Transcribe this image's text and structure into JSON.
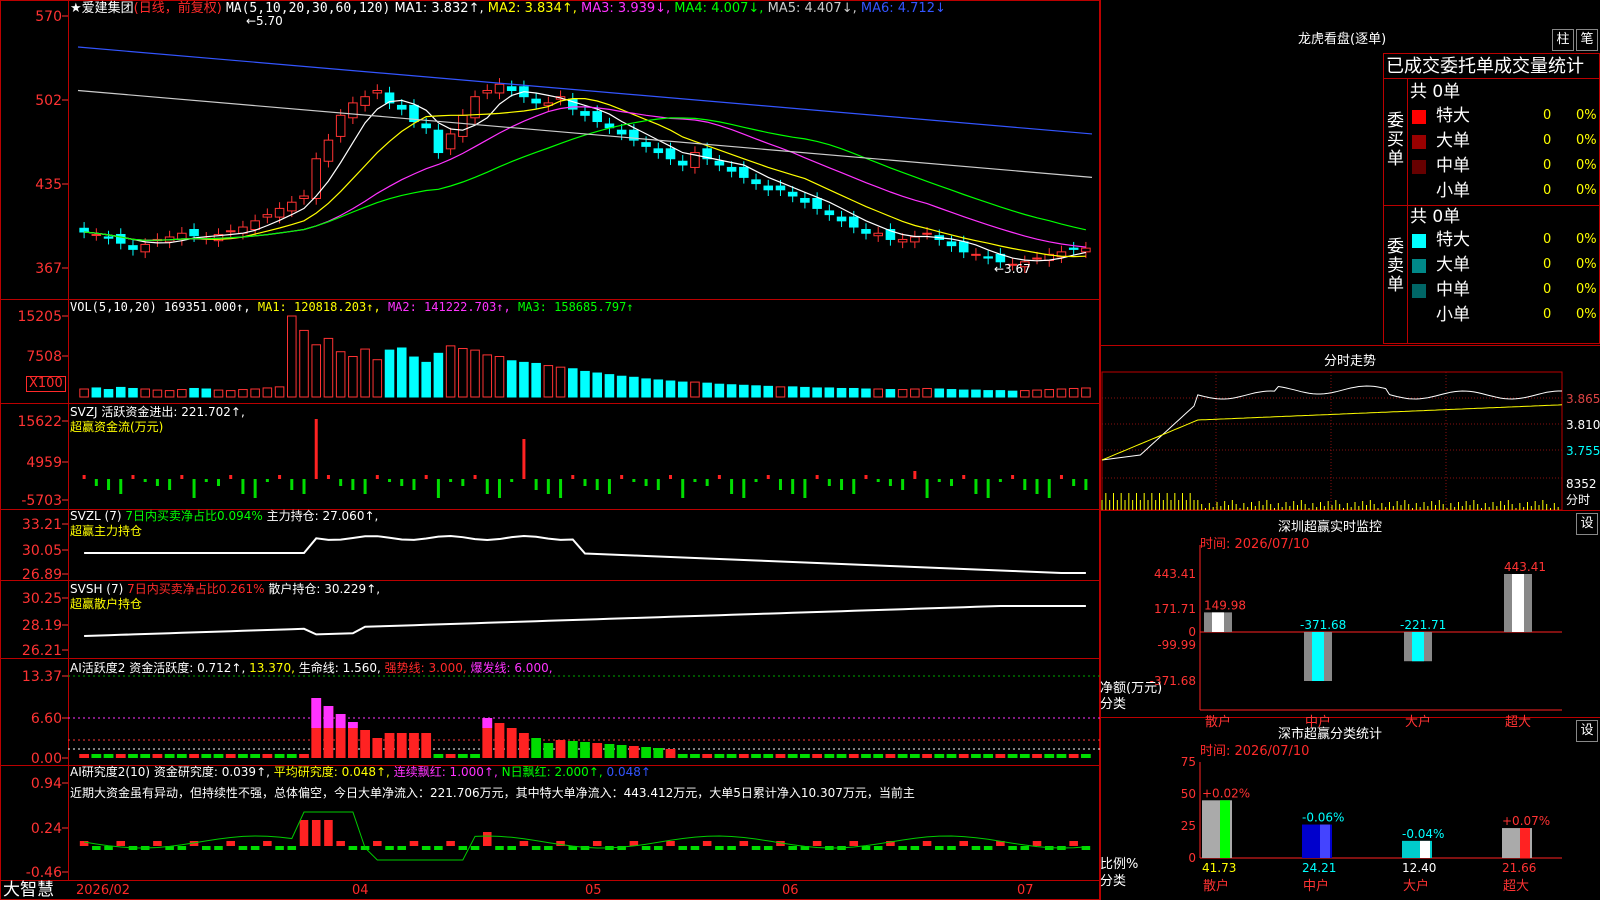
{
  "main": {
    "stock_name": "★爱建集团",
    "period": "(日线，前复权)",
    "ma_params": "MA(5,10,20,30,60,120)",
    "ma_values": [
      {
        "label": "MA1: 3.832↑,",
        "color": "#ffffff"
      },
      {
        "label": "MA2: 3.834↑,",
        "color": "#ffff00"
      },
      {
        "label": "MA3: 3.939↓,",
        "color": "#ff33ff"
      },
      {
        "label": "MA4: 4.007↓,",
        "color": "#00ff00"
      },
      {
        "label": "MA5: 4.407↓,",
        "color": "#cccccc"
      },
      {
        "label": "MA6: 4.712↓",
        "color": "#3355ff"
      }
    ],
    "axis": [
      "570",
      "502",
      "435",
      "367"
    ],
    "high_marker": "←5.70",
    "low_marker": "←3.67"
  },
  "volume": {
    "header": "VOL(5,10,20)",
    "value": "169351.000↑,",
    "ma1": "MA1: 120818.203↑,",
    "ma2": "MA2: 141222.703↑,",
    "ma3": "MA3: 158685.797↑",
    "axis": [
      "15205",
      "7508"
    ],
    "unit": "X100"
  },
  "svzj": {
    "header": "SVZJ",
    "line1": "活跃资金进出: 221.702↑,",
    "line2": "超赢资金流(万元)",
    "axis": [
      "15622",
      "4959",
      "-5703"
    ]
  },
  "svzl": {
    "header": "SVZL (7)",
    "ratio": "7日内买卖净占比0.094%",
    "hold": "主力持仓: 27.060↑,",
    "line2": "超赢主力持仓",
    "axis": [
      "33.21",
      "30.05",
      "26.89"
    ]
  },
  "svsh": {
    "header": "SVSH (7)",
    "ratio": "7日内买卖净占比0.261%",
    "hold": "散户持仓: 30.229↑,",
    "line2": "超赢散户持仓",
    "axis": [
      "30.25",
      "28.19",
      "26.21"
    ]
  },
  "ai_active": {
    "header": "AI活跃度2",
    "v1": "资金活跃度: 0.712↑,",
    "v2": "13.370,",
    "v3": "生命线: 1.560,",
    "v4": "强势线: 3.000,",
    "v5": "爆发线: 6.000,",
    "axis": [
      "13.37",
      "6.60",
      "0.00"
    ]
  },
  "ai_research": {
    "header": "AI研究度2(10)",
    "v1": "资金研究度: 0.039↑,",
    "v2": "平均研究度: 0.048↑,",
    "v3": "连续飘红: 1.000↑,",
    "v4": "N日飘红: 2.000↑,",
    "v5": "0.048↑",
    "note": "近期大资金虽有异动，但持续性不强，总体偏空，今日大单净流入：221.706万元，其中特大单净流入：443.412万元，大单5日累计净入10.307万元，当前主",
    "axis": [
      "0.94",
      "0.24",
      "-0.46"
    ]
  },
  "x_axis": {
    "brand": "大智慧",
    "labels": [
      "2026/02",
      "04",
      "05",
      "06",
      "07"
    ]
  },
  "right": {
    "lhb_title": "龙虎看盘(逐单)",
    "btn_zhu": "柱",
    "btn_bi": "笔",
    "tabs": "已成交委托单成交量统计",
    "buy_label": "委买单",
    "sell_label": "委卖单",
    "buy_total": "共 0单",
    "sell_total": "共 0单",
    "buy_rows": [
      {
        "name": "特大",
        "count": "0",
        "pct": "0%",
        "color": "#ff0000"
      },
      {
        "name": "大单",
        "count": "0",
        "pct": "0%",
        "color": "#990000"
      },
      {
        "name": "中单",
        "count": "0",
        "pct": "0%",
        "color": "#660000"
      },
      {
        "name": "小单",
        "count": "0",
        "pct": "0%",
        "color": ""
      }
    ],
    "sell_rows": [
      {
        "name": "特大",
        "count": "0",
        "pct": "0%",
        "color": "#00ffff"
      },
      {
        "name": "大单",
        "count": "0",
        "pct": "0%",
        "color": "#008888"
      },
      {
        "name": "中单",
        "count": "0",
        "pct": "0%",
        "color": "#006666"
      },
      {
        "name": "小单",
        "count": "0",
        "pct": "0%",
        "color": ""
      }
    ],
    "fs_title": "分时走势",
    "fs_axis": [
      "3.865",
      "3.810",
      "3.755"
    ],
    "fs_vol": "8352",
    "fs_unit": "分时",
    "sz_title": "深圳超赢实时监控",
    "sz_btn": "设",
    "sz_time": "时间: 2026/07/10",
    "sz_axis": [
      "443.41",
      "171.71",
      "0",
      "-99.99",
      "-371.68"
    ],
    "sz_axis_label1": "净额(万元)",
    "sz_axis_label2": "分类",
    "sz_bars": [
      {
        "cat": "散户",
        "value": "149.98"
      },
      {
        "cat": "中户",
        "value": "-371.68"
      },
      {
        "cat": "大户",
        "value": "-221.71"
      },
      {
        "cat": "超大",
        "value": "443.41"
      }
    ],
    "sm_title": "深市超赢分类统计",
    "sm_btn": "设",
    "sm_time": "时间: 2026/07/10",
    "sm_axis": [
      "75",
      "50",
      "25",
      "0"
    ],
    "sm_axis_label1": "比例%",
    "sm_axis_label2": "分类",
    "sm_bars": [
      {
        "cat": "散户",
        "value": "41.73",
        "chg": "+0.02%"
      },
      {
        "cat": "中户",
        "value": "24.21",
        "chg": "-0.06%"
      },
      {
        "cat": "大户",
        "value": "12.40",
        "chg": "-0.04%"
      },
      {
        "cat": "超大",
        "value": "21.66",
        "chg": "+0.07%"
      }
    ]
  },
  "chart_data": [
    {
      "type": "line",
      "title": "★爱建集团 (日线，前复权)",
      "series_hint": "daily candlestick with moving averages",
      "ylim": [
        3.67,
        5.7
      ],
      "close": [
        3.96,
        3.94,
        3.91,
        3.87,
        3.82,
        3.86,
        3.9,
        3.92,
        3.95,
        3.93,
        3.91,
        3.94,
        3.97,
        4.0,
        4.05,
        4.1,
        4.15,
        4.2,
        4.25,
        4.55,
        4.7,
        4.9,
        5.0,
        5.05,
        5.1,
        5.0,
        4.95,
        4.85,
        4.8,
        4.6,
        4.75,
        4.9,
        5.05,
        5.1,
        5.15,
        5.1,
        5.05,
        5.0,
        5.0,
        5.05,
        4.95,
        4.9,
        4.85,
        4.8,
        4.75,
        4.7,
        4.65,
        4.6,
        4.55,
        4.5,
        4.6,
        4.55,
        4.5,
        4.45,
        4.4,
        4.35,
        4.3,
        4.3,
        4.25,
        4.2,
        4.15,
        4.1,
        4.05,
        4.0,
        3.95,
        3.95,
        3.9,
        3.9,
        3.92,
        3.95,
        3.9,
        3.85,
        3.8,
        3.78,
        3.75,
        3.72,
        3.7,
        3.72,
        3.75,
        3.78,
        3.8,
        3.82,
        3.83
      ]
    },
    {
      "type": "bar",
      "title": "VOL(5,10,20)",
      "ylim": [
        0,
        15205
      ],
      "values": [
        1500,
        1700,
        1400,
        1800,
        1600,
        1500,
        1300,
        1200,
        1400,
        1600,
        1500,
        1300,
        1200,
        1400,
        1500,
        1700,
        1900,
        15205,
        12500,
        9800,
        11000,
        8500,
        7600,
        9000,
        7000,
        8800,
        9200,
        7500,
        6500,
        8200,
        9600,
        9100,
        8800,
        7900,
        7600,
        6800,
        6500,
        6300,
        5900,
        5600,
        5300,
        4800,
        4500,
        4200,
        3900,
        3700,
        3400,
        3200,
        3000,
        2800,
        2800,
        2600,
        2400,
        2300,
        2200,
        2100,
        2000,
        1900,
        1900,
        1800,
        1700,
        1700,
        1600,
        1600,
        1500,
        1500,
        1400,
        1400,
        1500,
        1600,
        1500,
        1400,
        1300,
        1300,
        1200,
        1200,
        1100,
        1200,
        1300,
        1400,
        1500,
        1600,
        1693
      ]
    },
    {
      "type": "bar",
      "title": "深圳超赢实时监控",
      "categories": [
        "散户",
        "中户",
        "大户",
        "超大"
      ],
      "values": [
        149.98,
        -371.68,
        -221.71,
        443.41
      ],
      "ylim": [
        -371.68,
        443.41
      ]
    },
    {
      "type": "bar",
      "title": "深市超赢分类统计",
      "categories": [
        "散户",
        "中户",
        "大户",
        "超大"
      ],
      "values": [
        41.73,
        24.21,
        12.4,
        21.66
      ],
      "ylim": [
        0,
        75
      ]
    }
  ]
}
